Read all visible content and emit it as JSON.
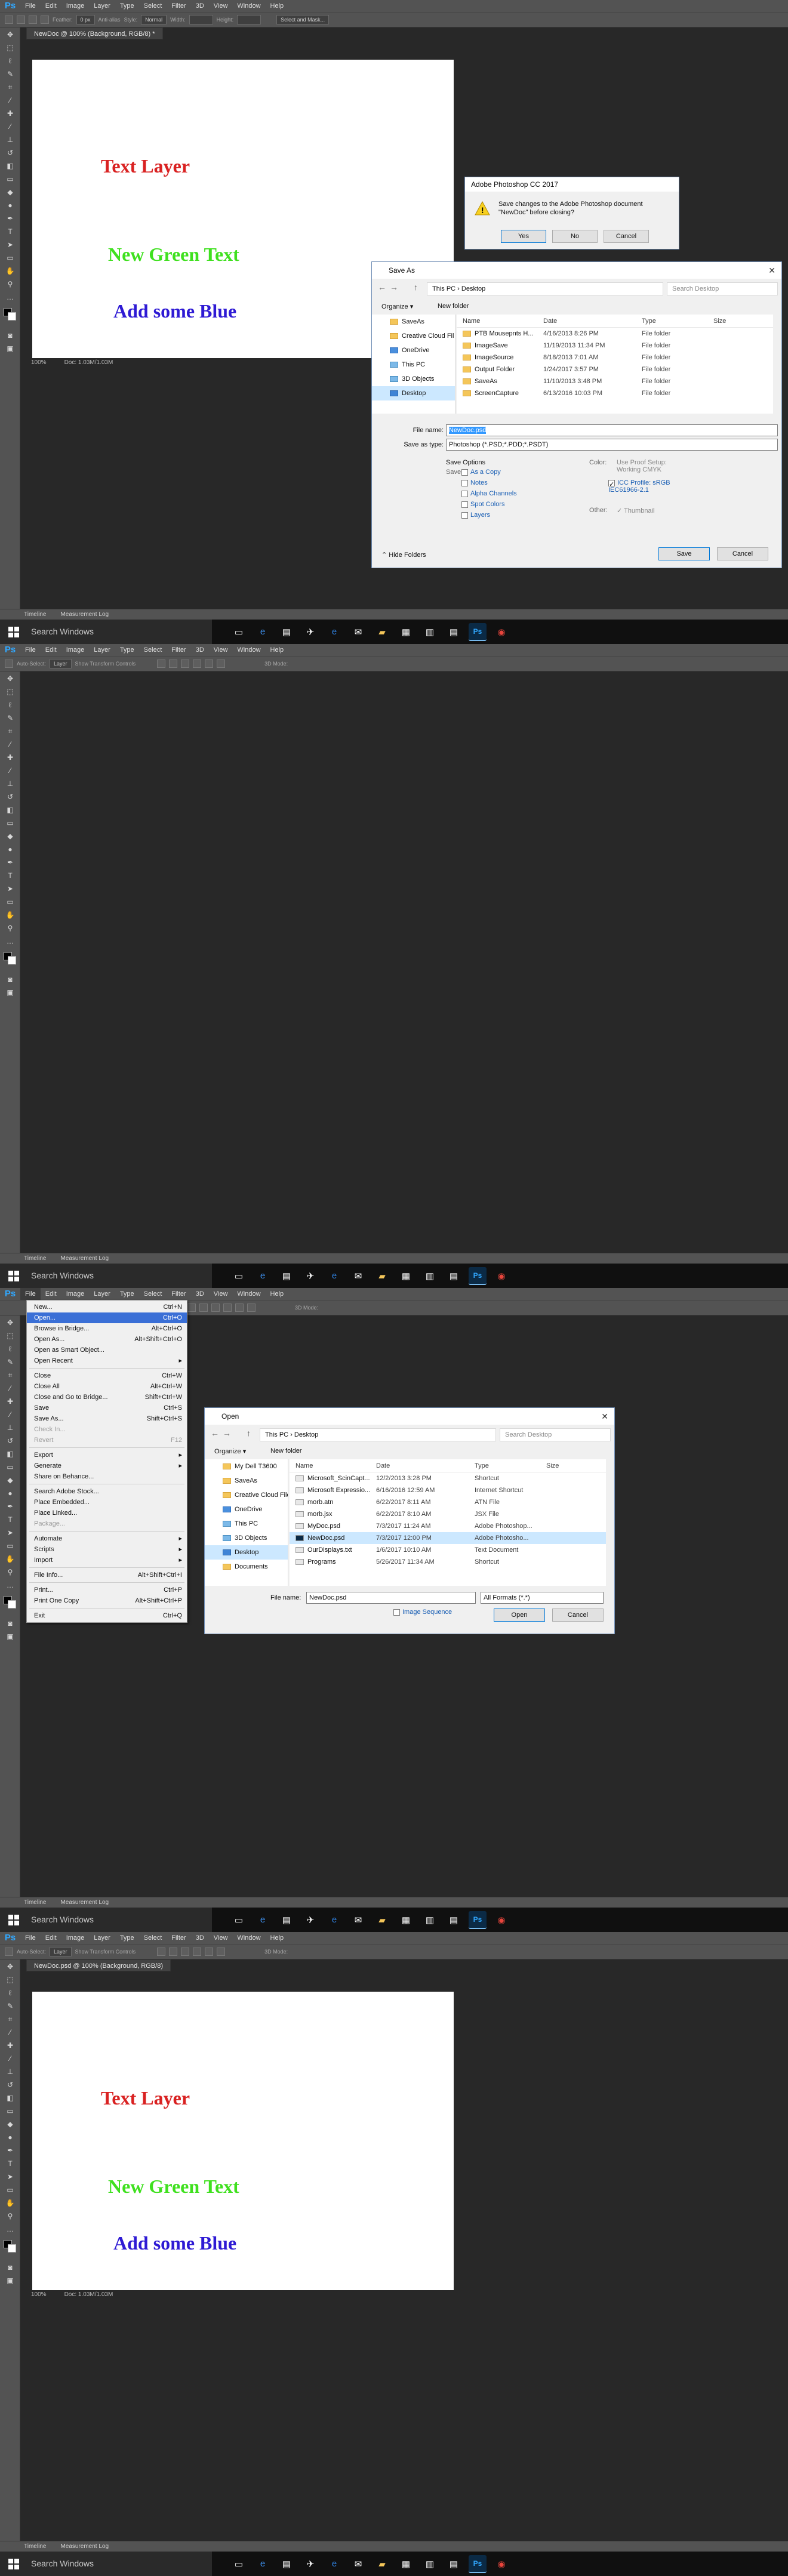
{
  "app": {
    "logo": "Ps",
    "menu": [
      "File",
      "Edit",
      "Image",
      "Layer",
      "Type",
      "Select",
      "Filter",
      "3D",
      "View",
      "Window",
      "Help"
    ]
  },
  "options_bar_f1": {
    "feather_label": "Feather:",
    "feather_value": "0 px",
    "antialias": "Anti-alias",
    "style_label": "Style:",
    "style_value": "Normal",
    "width_label": "Width:",
    "height_label": "Height:",
    "select_mask": "Select and Mask..."
  },
  "options_bar_move": {
    "auto_select": "Auto-Select:",
    "layer": "Layer",
    "show_transform": "Show Transform Controls",
    "mode_3d": "3D Mode:"
  },
  "document": {
    "tab_f1": "NewDoc @ 100% (Background, RGB/8) *",
    "tab_f4": "NewDoc.psd @ 100% (Background, RGB/8)",
    "zoom": "100%",
    "doc_size": "Doc: 1.03M/1.03M",
    "layers": {
      "red": "Text Layer",
      "green": "New Green Text",
      "blue": "Add some Blue"
    },
    "colors": {
      "red": "#d92121",
      "green": "#3fe01f",
      "blue": "#2e1ad4"
    }
  },
  "bottom_panel": {
    "timeline": "Timeline",
    "measurement_log": "Measurement Log"
  },
  "taskbar": {
    "search_placeholder": "Search Windows"
  },
  "save_changes_dialog": {
    "title": "Adobe Photoshop CC 2017",
    "message": "Save changes to the Adobe Photoshop document \"NewDoc\" before closing?",
    "yes": "Yes",
    "no": "No",
    "cancel": "Cancel"
  },
  "save_as_dialog": {
    "title": "Save As",
    "address": [
      "This PC",
      "Desktop"
    ],
    "search_placeholder": "Search Desktop",
    "organize": "Organize",
    "new_folder": "New folder",
    "nav": [
      "SaveAs",
      "Creative Cloud Fil",
      "OneDrive",
      "This PC",
      "3D Objects",
      "Desktop"
    ],
    "columns": [
      "Name",
      "Date",
      "Type",
      "Size"
    ],
    "files": [
      {
        "name": "PTB Mousepnts H...",
        "date": "4/16/2013 8:26 PM",
        "type": "File folder"
      },
      {
        "name": "ImageSave",
        "date": "11/19/2013 11:34 PM",
        "type": "File folder"
      },
      {
        "name": "ImageSource",
        "date": "8/18/2013 7:01 AM",
        "type": "File folder"
      },
      {
        "name": "Output Folder",
        "date": "1/24/2017 3:57 PM",
        "type": "File folder"
      },
      {
        "name": "SaveAs",
        "date": "11/10/2013 3:48 PM",
        "type": "File folder"
      },
      {
        "name": "ScreenCapture",
        "date": "6/13/2016 10:03 PM",
        "type": "File folder"
      }
    ],
    "filename_label": "File name:",
    "filename_value": "NewDoc.psd",
    "saveas_type_label": "Save as type:",
    "saveas_type_value": "Photoshop (*.PSD;*.PDD;*.PSDT)",
    "save_options": "Save Options",
    "save_label": "Save:",
    "as_a_copy": "As a Copy",
    "notes": "Notes",
    "alpha_channels": "Alpha Channels",
    "spot_colors": "Spot Colors",
    "layers": "Layers",
    "color_label": "Color:",
    "use_proof": "Use Proof Setup:",
    "working_cmyk": "Working CMYK",
    "icc_profile": "ICC Profile: sRGB IEC61966-2.1",
    "other_label": "Other:",
    "thumbnail": "Thumbnail",
    "hide_folders": "Hide Folders",
    "save_btn": "Save",
    "cancel_btn": "Cancel"
  },
  "file_menu": [
    {
      "label": "New...",
      "shortcut": "Ctrl+N"
    },
    {
      "label": "Open...",
      "shortcut": "Ctrl+O",
      "highlight": true
    },
    {
      "label": "Browse in Bridge...",
      "shortcut": "Alt+Ctrl+O"
    },
    {
      "label": "Open As...",
      "shortcut": "Alt+Shift+Ctrl+O"
    },
    {
      "label": "Open as Smart Object...",
      "shortcut": ""
    },
    {
      "label": "Open Recent",
      "shortcut": "▸"
    },
    {
      "sep": true
    },
    {
      "label": "Close",
      "shortcut": "Ctrl+W"
    },
    {
      "label": "Close All",
      "shortcut": "Alt+Ctrl+W"
    },
    {
      "label": "Close and Go to Bridge...",
      "shortcut": "Shift+Ctrl+W"
    },
    {
      "label": "Save",
      "shortcut": "Ctrl+S"
    },
    {
      "label": "Save As...",
      "shortcut": "Shift+Ctrl+S"
    },
    {
      "label": "Check In...",
      "shortcut": "",
      "disabled": true
    },
    {
      "label": "Revert",
      "shortcut": "F12",
      "disabled": true
    },
    {
      "sep": true
    },
    {
      "label": "Export",
      "shortcut": "▸"
    },
    {
      "label": "Generate",
      "shortcut": "▸"
    },
    {
      "label": "Share on Behance...",
      "shortcut": ""
    },
    {
      "sep": true
    },
    {
      "label": "Search Adobe Stock...",
      "shortcut": ""
    },
    {
      "label": "Place Embedded...",
      "shortcut": ""
    },
    {
      "label": "Place Linked...",
      "shortcut": ""
    },
    {
      "label": "Package...",
      "shortcut": "",
      "disabled": true
    },
    {
      "sep": true
    },
    {
      "label": "Automate",
      "shortcut": "▸"
    },
    {
      "label": "Scripts",
      "shortcut": "▸"
    },
    {
      "label": "Import",
      "shortcut": "▸"
    },
    {
      "sep": true
    },
    {
      "label": "File Info...",
      "shortcut": "Alt+Shift+Ctrl+I"
    },
    {
      "sep": true
    },
    {
      "label": "Print...",
      "shortcut": "Ctrl+P"
    },
    {
      "label": "Print One Copy",
      "shortcut": "Alt+Shift+Ctrl+P"
    },
    {
      "sep": true
    },
    {
      "label": "Exit",
      "shortcut": "Ctrl+Q"
    }
  ],
  "open_dialog": {
    "title": "Open",
    "address": [
      "This PC",
      "Desktop"
    ],
    "search_placeholder": "Search Desktop",
    "organize": "Organize",
    "new_folder": "New folder",
    "nav": [
      "My Dell T3600",
      "SaveAs",
      "Creative Cloud Files",
      "OneDrive",
      "This PC",
      "3D Objects",
      "Desktop",
      "Documents"
    ],
    "columns": [
      "Name",
      "Date",
      "Type",
      "Size"
    ],
    "files": [
      {
        "name": "Microsoft_ScinCapt...",
        "date": "12/2/2013 3:28 PM",
        "type": "Shortcut"
      },
      {
        "name": "Microsoft Expressio...",
        "date": "6/16/2016 12:59 AM",
        "type": "Internet Shortcut"
      },
      {
        "name": "morb.atn",
        "date": "6/22/2017 8:11 AM",
        "type": "ATN File"
      },
      {
        "name": "morb.jsx",
        "date": "6/22/2017 8:10 AM",
        "type": "JSX File"
      },
      {
        "name": "MyDoc.psd",
        "date": "7/3/2017 11:24 AM",
        "type": "Adobe Photoshop..."
      },
      {
        "name": "NewDoc.psd",
        "date": "7/3/2017 12:00 PM",
        "type": "Adobe Photosho...",
        "highlight": true
      },
      {
        "name": "OurDisplays.txt",
        "date": "1/6/2017 10:10 AM",
        "type": "Text Document"
      },
      {
        "name": "Programs",
        "date": "5/26/2017 11:34 AM",
        "type": "Shortcut"
      }
    ],
    "filename_label": "File name:",
    "filename_value": "NewDoc.psd",
    "filter_value": "All Formats (*.*)",
    "image_sequence": "Image Sequence",
    "open_btn": "Open",
    "cancel_btn": "Cancel"
  }
}
